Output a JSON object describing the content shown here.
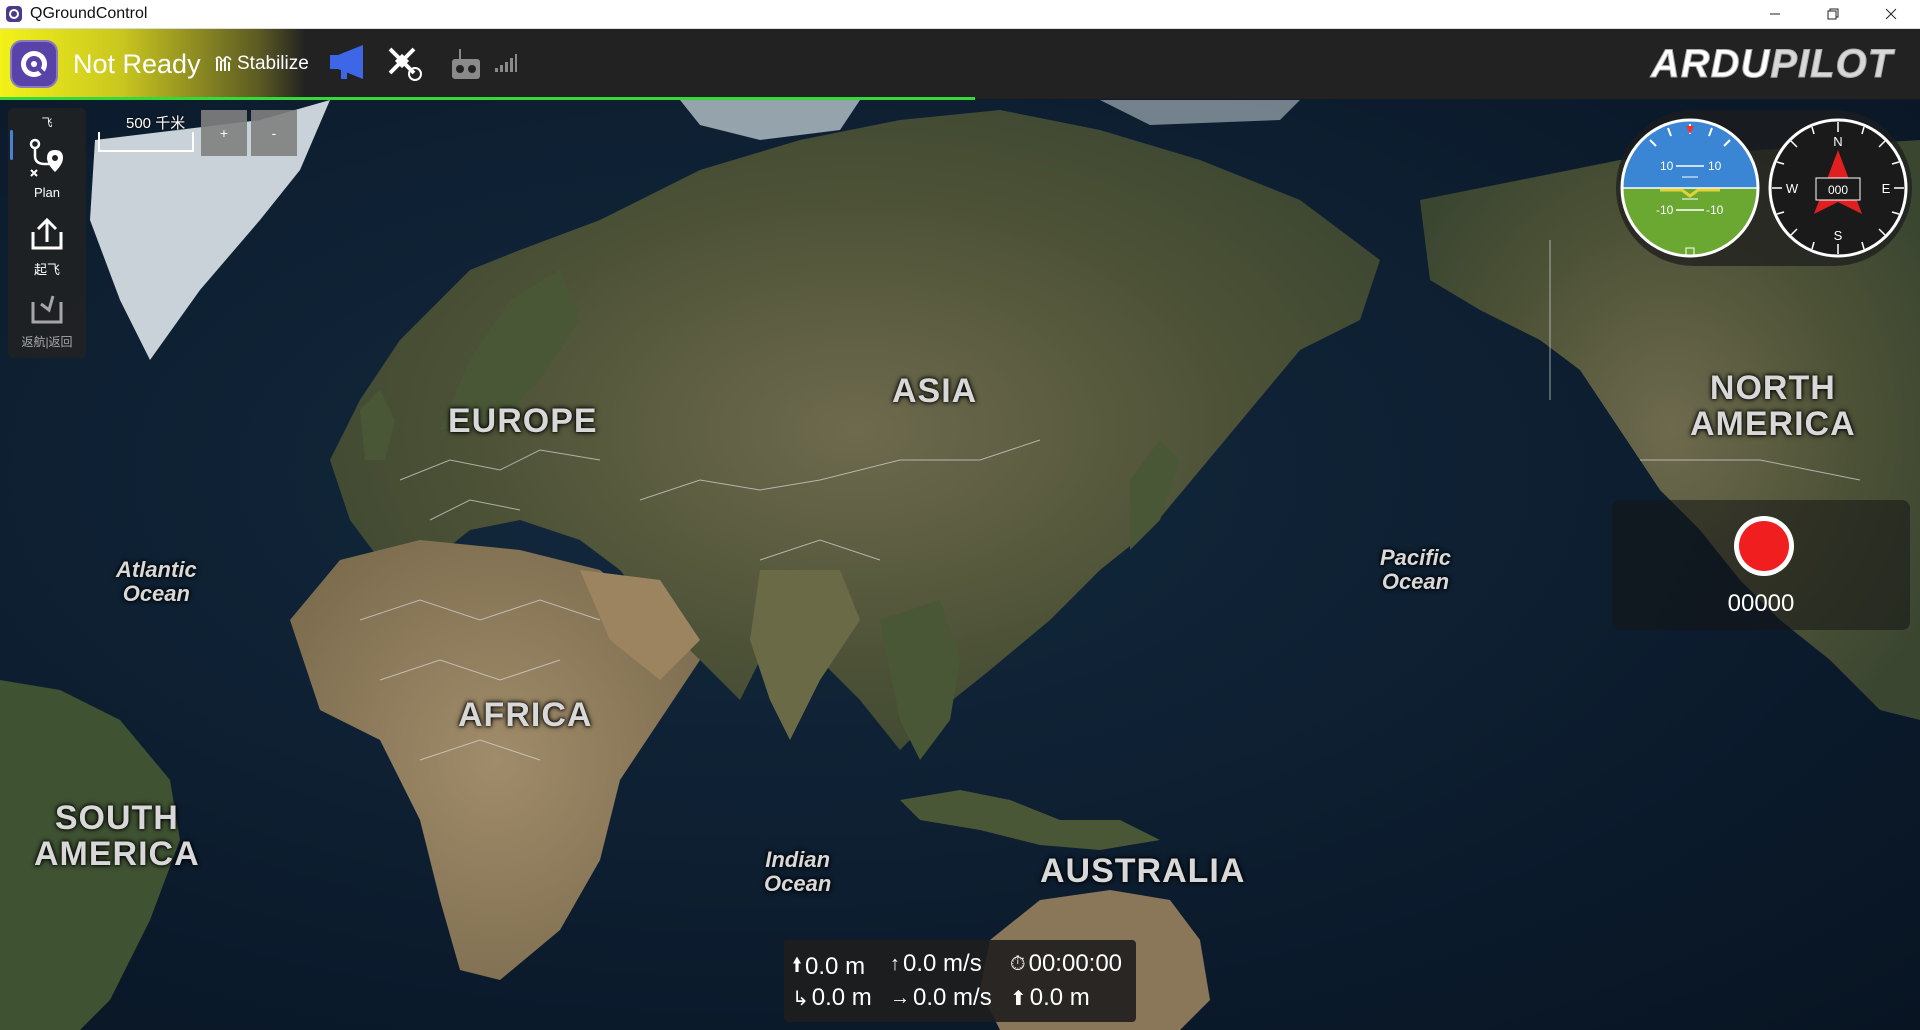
{
  "window": {
    "title": "QGroundControl",
    "controls": [
      "minimize-icon",
      "restore-icon",
      "close-icon"
    ]
  },
  "toolbar": {
    "status": "Not Ready",
    "flight_mode": "Stabilize",
    "icons": [
      "qgc-logo",
      "megaphone-icon",
      "gps-satellite-icon",
      "rc-transmitter-icon",
      "signal-bars-icon"
    ],
    "brand_logo_text": "ARDUPILOT",
    "colors": {
      "status_gradient_start": "#f2f219",
      "progress": "#36d93a",
      "toolbar_bg": "#222222"
    }
  },
  "tools": {
    "top_label": "飞",
    "plan_label": "Plan",
    "takeoff_label": "起飞",
    "rtl_label": "返航|返回"
  },
  "map": {
    "scale_label": "500 千米",
    "zoom_in_label": "+",
    "zoom_out_label": "-",
    "labels": {
      "asia": "ASIA",
      "europe": "EUROPE",
      "africa": "AFRICA",
      "north_america_1": "NORTH",
      "north_america_2": "AMERICA",
      "south_america_1": "SOUTH",
      "south_america_2": "AMERICA",
      "australia": "AUSTRALIA",
      "atlantic_1": "Atlantic",
      "atlantic_2": "Ocean",
      "pacific_1": "Pacific",
      "pacific_2": "Ocean",
      "indian_1": "Indian",
      "indian_2": "Ocean"
    }
  },
  "instruments": {
    "attitude": {
      "pitch_up_left": "10",
      "pitch_up_right": "10",
      "pitch_down_left": "-10",
      "pitch_down_right": "-10"
    },
    "compass": {
      "n": "N",
      "e": "E",
      "s": "S",
      "w": "W",
      "heading": "000"
    }
  },
  "recording": {
    "time": "00000",
    "button_color": "#f01e1e"
  },
  "telemetry": {
    "altitude": "0.0 m",
    "vertical_speed": "0.0 m/s",
    "flight_time": "00:00:00",
    "distance": "0.0 m",
    "horizontal_speed": "0.0 m/s",
    "distance_to_home": "0.0 m"
  }
}
